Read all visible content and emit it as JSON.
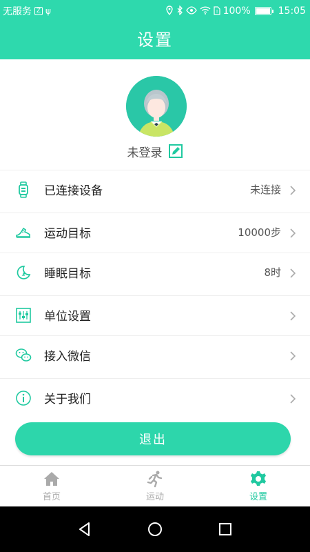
{
  "status_bar": {
    "carrier": "无服务",
    "battery": "100%",
    "battery_level": 1.0,
    "time": "15:05"
  },
  "header": {
    "title": "设置"
  },
  "profile": {
    "username": "未登录"
  },
  "menu": {
    "items": [
      {
        "label": "已连接设备",
        "value": "未连接",
        "icon": "watch-icon"
      },
      {
        "label": "运动目标",
        "value": "10000步",
        "icon": "sneaker-icon"
      },
      {
        "label": "睡眠目标",
        "value": "8时",
        "icon": "moon-icon"
      },
      {
        "label": "单位设置",
        "value": "",
        "icon": "sliders-icon"
      },
      {
        "label": "接入微信",
        "value": "",
        "icon": "wechat-icon"
      },
      {
        "label": "关于我们",
        "value": "",
        "icon": "info-icon"
      }
    ]
  },
  "logout": {
    "label": "退出"
  },
  "tabs": [
    {
      "label": "首页",
      "icon": "home-icon",
      "active": false
    },
    {
      "label": "运动",
      "icon": "running-icon",
      "active": false
    },
    {
      "label": "设置",
      "icon": "gear-icon",
      "active": true
    }
  ],
  "colors": {
    "accent": "#2ed9ad",
    "text": "#222222",
    "muted": "#aaaaaa"
  }
}
